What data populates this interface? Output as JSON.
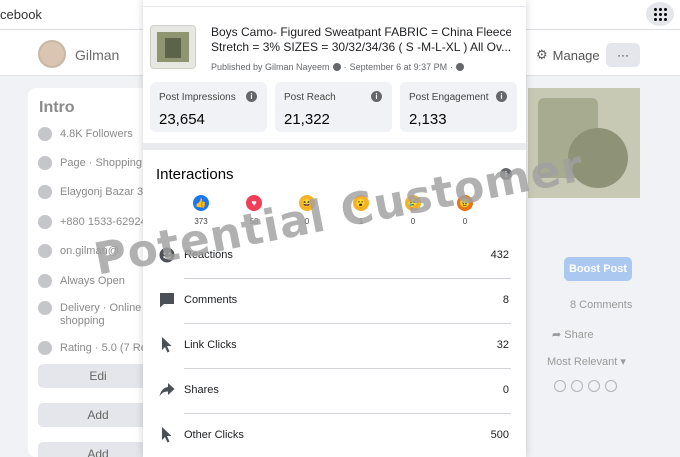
{
  "background": {
    "top_left_text": "cebook",
    "page_name": "Gilman",
    "manage_label": "Manage",
    "more_label": "···",
    "intro": {
      "title": "Intro",
      "items": [
        "4.8K Followers",
        "Page · Shopping S",
        "Elaygonj Bazar 31",
        "+880 1533-62924",
        "on.gilman@",
        "Always Open",
        "Delivery · Online L",
        "shopping",
        "Rating · 5.0 (7 Re"
      ],
      "buttons": [
        "Edi",
        "Add",
        "Add"
      ]
    },
    "boost_label": "Boost Post",
    "comments_count": "8 Comments",
    "share_label": "Share",
    "sort_label": "Most Relevant"
  },
  "post": {
    "title_line1": "Boys Camo- Figured Sweatpant FABRIC = China Fleece",
    "title_line2": "Stretch = 3% SIZES = 30/32/34/36 ( S -M-L-XL ) All Ov...",
    "meta": "Published by Gilman Nayeem",
    "date": "September 6 at 9:37 PM"
  },
  "stats": [
    {
      "label": "Post Impressions",
      "value": "23,654"
    },
    {
      "label": "Post Reach",
      "value": "21,322"
    },
    {
      "label": "Post Engagement",
      "value": "2,133"
    }
  ],
  "interactions": {
    "title": "Interactions",
    "reactions": [
      {
        "icon": "like",
        "count": "373",
        "color": "#1877f2"
      },
      {
        "icon": "love",
        "count": "58",
        "color": "#f33e58"
      },
      {
        "icon": "haha",
        "count": "0",
        "color": "#f7b125"
      },
      {
        "icon": "wow",
        "count": "1",
        "color": "#f7b125"
      },
      {
        "icon": "sad",
        "count": "0",
        "color": "#f7b125"
      },
      {
        "icon": "angry",
        "count": "0",
        "color": "#e9710f"
      }
    ],
    "rows": [
      {
        "label": "Reactions",
        "value": "432"
      },
      {
        "label": "Comments",
        "value": "8"
      },
      {
        "label": "Link Clicks",
        "value": "32"
      },
      {
        "label": "Shares",
        "value": "0"
      },
      {
        "label": "Other Clicks",
        "value": "500"
      }
    ]
  },
  "watermark": "Potential Customer"
}
